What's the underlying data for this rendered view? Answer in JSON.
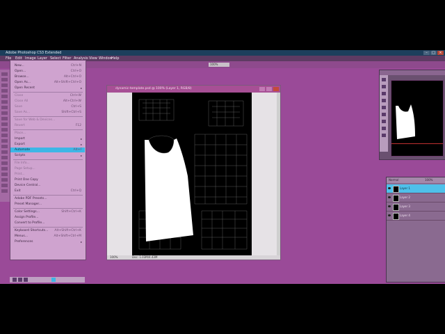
{
  "app": {
    "title": "Adobe Photoshop CS3 Extended"
  },
  "menubar": [
    "File",
    "Edit",
    "Image",
    "Layer",
    "Select",
    "Filter",
    "Analysis",
    "View",
    "Window",
    "Help"
  ],
  "options": {
    "field_value": "100%"
  },
  "file_menu": {
    "items": [
      {
        "label": "New...",
        "shortcut": "Ctrl+N",
        "disabled": false
      },
      {
        "label": "Open...",
        "shortcut": "Ctrl+O",
        "disabled": false
      },
      {
        "label": "Browse...",
        "shortcut": "Alt+Ctrl+O",
        "disabled": false
      },
      {
        "label": "Open As...",
        "shortcut": "Alt+Shift+Ctrl+O",
        "disabled": false
      },
      {
        "label": "Open Recent",
        "shortcut": "",
        "disabled": false,
        "submenu": true
      },
      {
        "label": "Close",
        "shortcut": "Ctrl+W",
        "disabled": true
      },
      {
        "label": "Close All",
        "shortcut": "Alt+Ctrl+W",
        "disabled": true
      },
      {
        "label": "Save",
        "shortcut": "Ctrl+S",
        "disabled": true
      },
      {
        "label": "Save As...",
        "shortcut": "Shift+Ctrl+S",
        "disabled": true
      },
      {
        "label": "Save for Web & Devices...",
        "shortcut": "",
        "disabled": true
      },
      {
        "label": "Revert",
        "shortcut": "F12",
        "disabled": true
      },
      {
        "label": "Place...",
        "shortcut": "",
        "disabled": true
      },
      {
        "label": "Import",
        "shortcut": "",
        "disabled": false,
        "submenu": true
      },
      {
        "label": "Export",
        "shortcut": "",
        "disabled": false,
        "submenu": true
      },
      {
        "label": "Automate",
        "shortcut": "Alt+F",
        "disabled": false,
        "highlighted": true,
        "submenu": true
      },
      {
        "label": "Scripts",
        "shortcut": "",
        "disabled": false,
        "submenu": true
      },
      {
        "label": "File Info...",
        "shortcut": "",
        "disabled": true
      },
      {
        "label": "Page Setup...",
        "shortcut": "",
        "disabled": true
      },
      {
        "label": "Print...",
        "shortcut": "",
        "disabled": true
      },
      {
        "label": "Print One Copy",
        "shortcut": "",
        "disabled": false
      },
      {
        "label": "Device Central...",
        "shortcut": "",
        "disabled": false
      },
      {
        "label": "Exit",
        "shortcut": "Ctrl+Q",
        "disabled": false,
        "submenu": false
      },
      {
        "label": "Adobe PDF Presets...",
        "shortcut": "",
        "disabled": false
      },
      {
        "label": "Preset Manager...",
        "shortcut": "",
        "disabled": false
      },
      {
        "label": "Color Settings...",
        "shortcut": "Shift+Ctrl+K",
        "disabled": false
      },
      {
        "label": "Assign Profile...",
        "shortcut": "",
        "disabled": false
      },
      {
        "label": "Convert to Profile...",
        "shortcut": "",
        "disabled": false
      },
      {
        "label": "Keyboard Shortcuts...",
        "shortcut": "Alt+Shift+Ctrl+K",
        "disabled": false
      },
      {
        "label": "Menus...",
        "shortcut": "Alt+Shift+Ctrl+M",
        "disabled": false
      },
      {
        "label": "Preferences",
        "shortcut": "",
        "disabled": false,
        "submenu": true
      }
    ]
  },
  "document": {
    "title": "dynamic-template.psd @ 100% (Layer 1, RGB/8)",
    "zoom": "100%",
    "status": "Doc: 1.03M/4.43M"
  },
  "layers_panel": {
    "header": "Normal",
    "opacity": "100%",
    "layers": [
      "Layer 1",
      "Layer 2",
      "Layer 3",
      "Layer 4"
    ],
    "selected": 0
  }
}
